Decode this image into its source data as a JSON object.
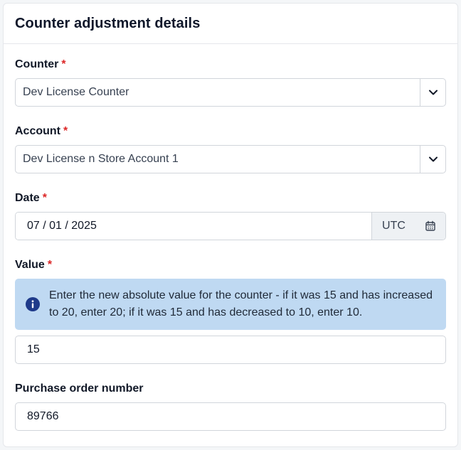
{
  "card": {
    "title": "Counter adjustment details"
  },
  "fields": {
    "counter": {
      "label": "Counter",
      "required_mark": "*",
      "value": "Dev License Counter"
    },
    "account": {
      "label": "Account",
      "required_mark": "*",
      "value": "Dev License n Store Account 1"
    },
    "date": {
      "label": "Date",
      "required_mark": "*",
      "value": "07 / 01 / 2025",
      "timezone": "UTC"
    },
    "value": {
      "label": "Value",
      "required_mark": "*",
      "hint": "Enter the new absolute value for the counter - if it was 15 and has increased to 20, enter 20; if it was 15 and has decreased to 10, enter 10.",
      "value": "15"
    },
    "po_number": {
      "label": "Purchase order number",
      "value": "89766"
    }
  },
  "colors": {
    "required": "#dc2626",
    "info_background": "#bfd9f2",
    "info_icon": "#1e3a8a"
  },
  "icons": {
    "select_toggle": "chevron-down-icon",
    "date_picker": "calendar-icon",
    "hint": "info-icon"
  }
}
